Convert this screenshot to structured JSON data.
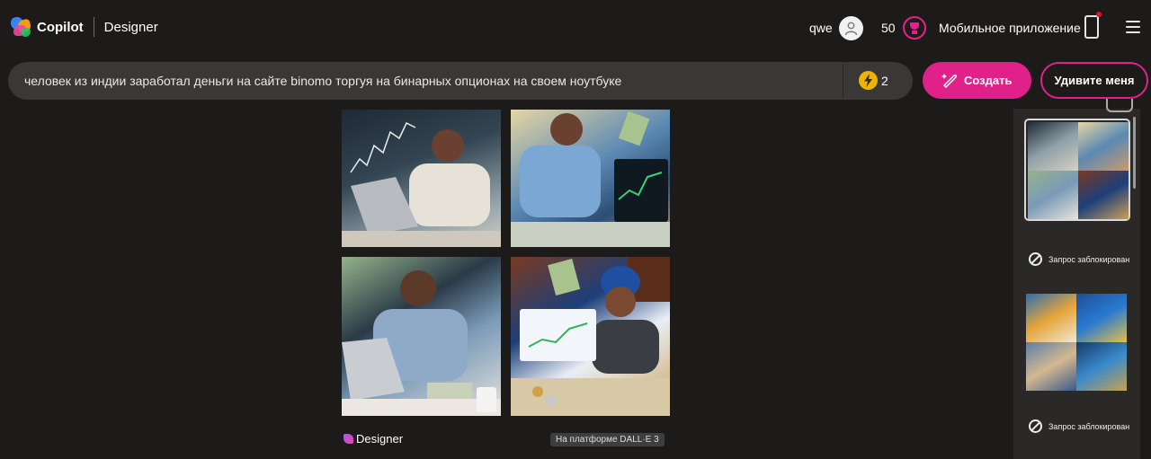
{
  "header": {
    "brand": "Copilot",
    "product": "Designer",
    "user_name": "qwe",
    "boost_count": "50",
    "mobile_app": "Мобильное приложение"
  },
  "prompt": {
    "text": "человек из индии заработал деньги на сайте binomo торгуя на бинарных опционах на своем ноутбуке",
    "coins": "2"
  },
  "actions": {
    "create": "Создать",
    "surprise": "Удивите меня"
  },
  "results": {
    "images": [
      {
        "icon": "generated-image"
      },
      {
        "icon": "generated-image"
      },
      {
        "icon": "generated-image"
      },
      {
        "icon": "generated-image"
      }
    ],
    "footer_brand": "Designer",
    "badge": "На платформе DALL·E 3"
  },
  "history": {
    "blocked_1": "Запрос заблокирован",
    "blocked_2": "Запрос заблокирован"
  },
  "colors": {
    "accent": "#e0218a",
    "background": "#1c1b1a",
    "prompt_bg": "#3a3837",
    "coin": "#f0b400"
  }
}
